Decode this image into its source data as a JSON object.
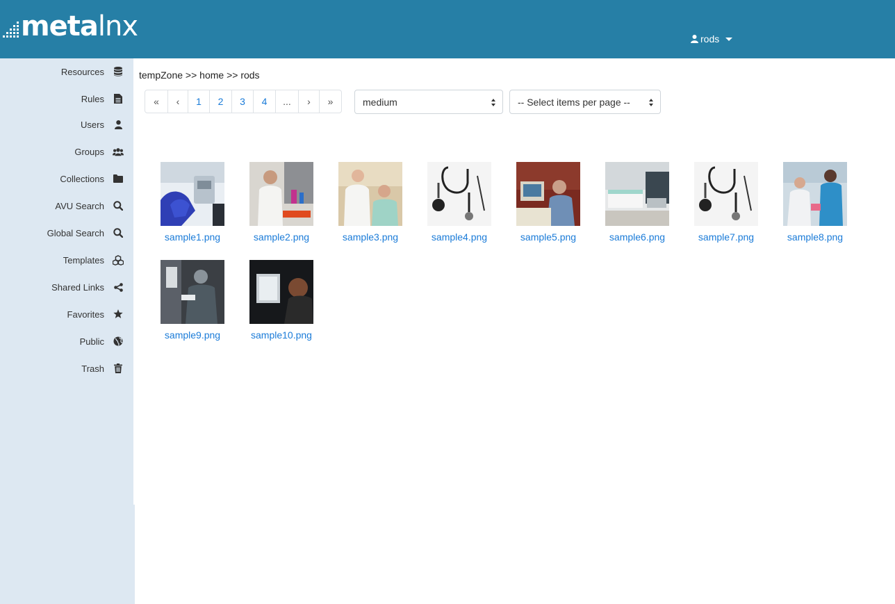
{
  "app": {
    "logo_text_bold": "meta",
    "logo_text_light": "lnx",
    "user": "rods"
  },
  "sidebar": {
    "items": [
      {
        "label": "Resources",
        "icon": "database-icon"
      },
      {
        "label": "Rules",
        "icon": "file-text-icon"
      },
      {
        "label": "Users",
        "icon": "user-icon"
      },
      {
        "label": "Groups",
        "icon": "users-icon"
      },
      {
        "label": "Collections",
        "icon": "folder-icon"
      },
      {
        "label": "AVU Search",
        "icon": "search-icon"
      },
      {
        "label": "Global Search",
        "icon": "search-icon"
      },
      {
        "label": "Templates",
        "icon": "cubes-icon"
      },
      {
        "label": "Shared Links",
        "icon": "share-icon"
      },
      {
        "label": "Favorites",
        "icon": "star-icon"
      },
      {
        "label": "Public",
        "icon": "globe-icon"
      },
      {
        "label": "Trash",
        "icon": "trash-icon"
      }
    ]
  },
  "breadcrumb": "tempZone >> home >> rods",
  "pager": {
    "first": "«",
    "prev": "‹",
    "pages": [
      "1",
      "2",
      "3",
      "4"
    ],
    "ellipsis": "...",
    "next": "›",
    "last": "»"
  },
  "size_select": {
    "value": "medium"
  },
  "per_page_select": {
    "value": "-- Select items per page --"
  },
  "files": [
    {
      "name": "sample1.png"
    },
    {
      "name": "sample2.png"
    },
    {
      "name": "sample3.png"
    },
    {
      "name": "sample4.png"
    },
    {
      "name": "sample5.png"
    },
    {
      "name": "sample6.png"
    },
    {
      "name": "sample7.png"
    },
    {
      "name": "sample8.png"
    },
    {
      "name": "sample9.png"
    },
    {
      "name": "sample10.png"
    }
  ],
  "colors": {
    "header": "#267fa6",
    "sidebar": "#dde8f2",
    "link": "#1a7bd8"
  }
}
